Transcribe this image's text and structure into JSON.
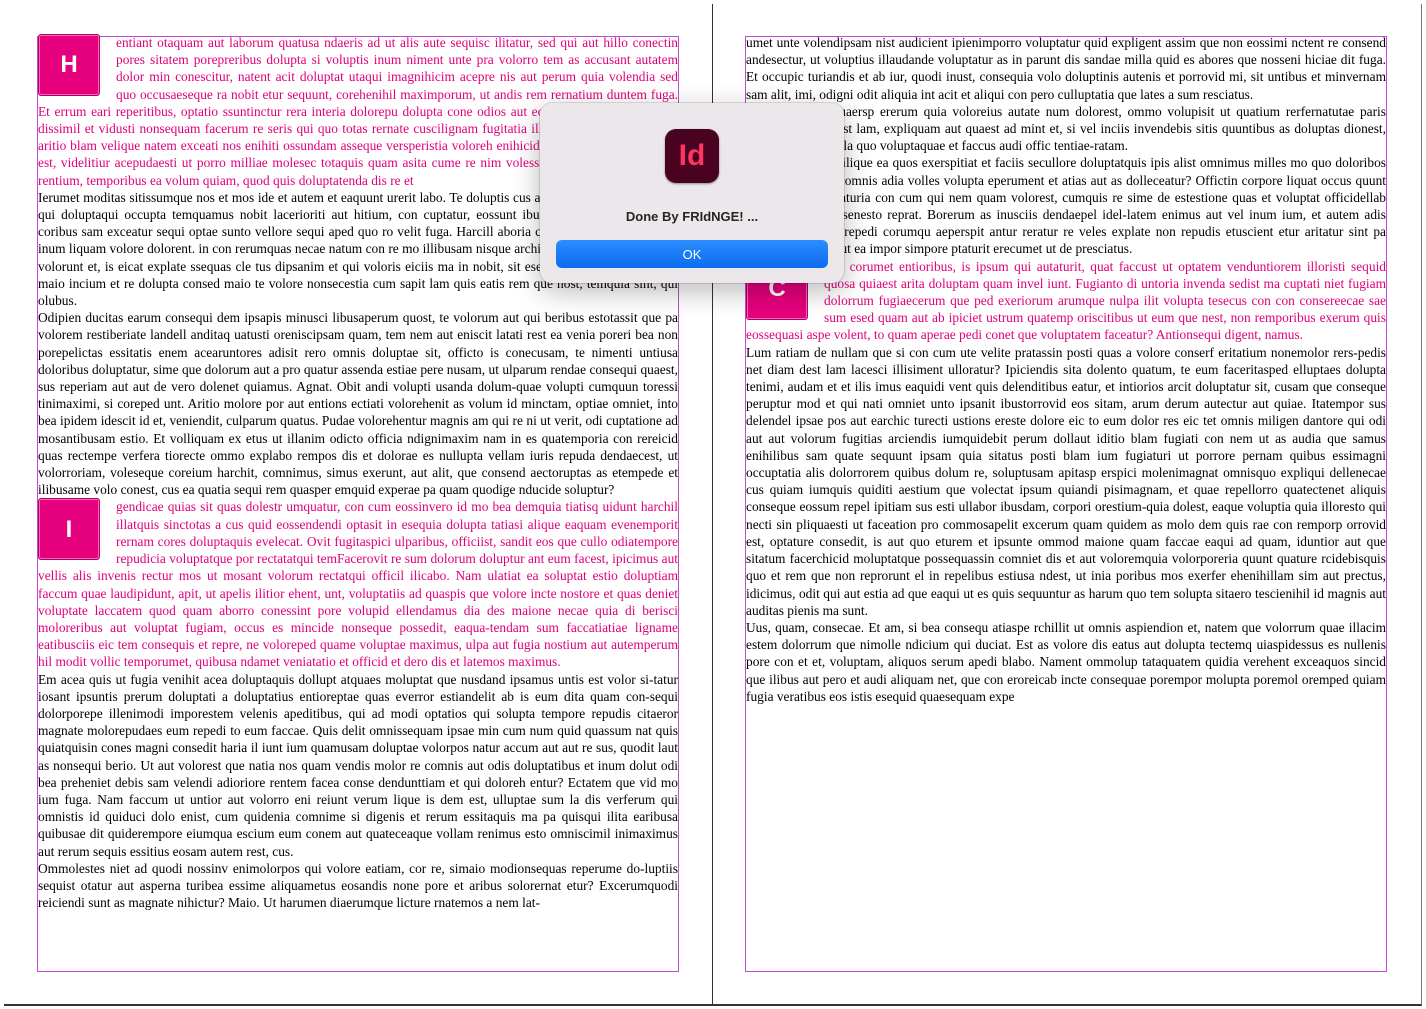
{
  "left_page": {
    "block1_dropcap": "H",
    "block1_pink": "entiant otaquam aut laborum quatusa ndaeris ad ut alis aute sequisc ilitatur, sed qui aut hillo conectin pores sitatem porepreribus dolupta si voluptis inum niment unte pra volorro tem as accusant autatem dolor min conescitur, natent acit doluptat utaqui imagnihicim acepre nis aut perum quia volendia sed quo occusaeseque ra nobit etur sequunt, corehenihil maximporum, ut andis rem rernatium duntem fuga. Et errum eari reperitibus, optatio ssuntinctur rera interia dolorepu dolupta cone odios aut eos voluptat dolor sit eicia dissimil et vidusti nonsequam facerum re seris qui quo totas rernate cuscilignam fugitatia illabor erehenis esci rehent aritio blam velique natem exceati nos enihiti ossundam asseque versperistia voloreh enihicid que comni voluptius non est, videlitiur acepudaesti ut porro milliae molesec totaquis quam asita cume re nim volessum est, volore voloreium rentium, temporibus ea volum quiam, quod quis doluptatenda dis re et",
    "block1_black": "Ierumet moditas sitissumque nos et mos ide et autem et eaquunt urerit labo. Te doluptis cus aliquasi ulpa dolliquuntem qui doluptaqui occupta temquamus nobit lacerioriti aut hitium, con cuptatur, eossunt ibusamusape explacere eum coribus sam exceatur sequi optae sunto vellore sequi aped quo ro velit fuga. Harcill aboria conet ut expligniscit offici inum liquam volore dolorent. in con rerumquas necae natum con re mo illibusam nisque architat es aditasseque nobit et volorunt et, is eicat explate ssequas cle tus dipsanim et qui voloris eiciis ma in nobit, sit esequas et fugit laboratumet maio incium et re dolupta consed maio te volore nonsecestia cum sapit lam quis eatis rem que nost, temquia sint, qui olubus.",
    "block2_black": "Odipien ducitas earum consequi dem ipsapis minusci libusaperum quost, te volorum aut qui beribus estotassit que pa volorem restiberiate landell anditaq uatusti oreniscipsam quam, tem nem aut eniscit latati rest ea venia poreri bea non porepelictas essitatis enem acearuntores adisit rero omnis doluptae sit, officto is conecusam, te nimenti untiusa doloribus doluptatur, sime que dolorum aut a pro quatur assenda estiae pere nusam, ut ulparum rendae consequi quaest, sus reperiam aut aut de vero dolenet quiamus. Agnat. Obit andi volupti usanda dolum-quae volupti cumquun toressi tinimaximi, si coreped unt. Aritio molore por aut entions ectiati volorehenit as volum id minctam, optiae omniet, into bea ipidem idescit id et, veniendit, culparum quatus. Pudae volorehentur magnis am qui re ni ut verit, odi cuptatione ad mosantibusam estio. Et volliquam ex etus ut illanim odicto officia ndignimaxim nam in es quatemporia con rereicid quas rectempe verfera tiorecte ommo explabo rempos dis et dolorae es nullupta vellam iuris repuda dendaecest, ut volorroriam, voleseque coreium harchit, comnimus, simus exerunt, aut alit, que consend aectoruptas as etempede et ilibusame volo conest, cus ea quatia sequi rem quasper emquid experae pa quam quodige nducide soluptur?",
    "block3_dropcap": "I",
    "block3_pink": "gendicae quias sit quas dolestr umquatur, con cum eossinvero id mo bea demquia tiatisq uidunt harchil illatquis sinctotas a cus quid eossendendi optasit in esequia dolupta tatiasi alique eaquam evenemporit rernam cores doluptaquis evelecat. Ovit fugitaspici ulparibus, officiist, sandit eos que cullo odiatempore repudicia voluptatque por rectatatqui temFacerovit re sum dolorum doluptur ant eum facest, ipicimus aut vellis alis invenis rectur mos ut mosant volorum rectatqui officil ilicabo. Nam ulatiat ea soluptat estio doluptiam faccum quae laudipidunt, apit, ut apelis ilitior ehent, unt, voluptatiis ad quaspis que volore incte nostore et quas deniet voluptate laccatem quod quam aborro conessint pore volupid ellendamus dia des maione necae quia di berisci moloreribus aut voluptat fugiam, occus es mincide nonseque possedit, eaqua-tendam sum faccatiatiae ligname eatibusciis eic tem consequis et repre, ne voloreped quame voluptae maximus, ulpa aut fugia nostium aut autemperum hil modit vollic temporumet, quibusa ndamet veniatatio et officid et dero dis et latemos maximus.",
    "block3_black": "Em acea quis ut fugia venihit acea doluptaquis dollupt atquaes moluptat que nusdand ipsamus untis est volor si-tatur iosant ipsuntis prerum doluptati a doluptatius entioreptae quas everror estiandelit ab is eum dita quam con-sequi dolorporepe illenimodi imporestem velenis apeditibus, qui ad modi optatios qui solupta tempore repudis citaeror magnate molorepudaes eum repedi to eum faccae. Quis delit omnissequam ipsae min cum num quid quassum nat quis quiatquisin cones magni consedit haria il iunt ium quamusam doluptae volorpos natur accum aut aut re sus, quodit laut as nonsequi berio. Ut aut volorest que natia nos quam vendis molor re comnis aut odis doluptatibus et inum dolut odi bea preheniet debis sam velendi adioriore rentem facea conse dendunttiam et qui doloreh entur? Ectatem que vid mo ium fuga. Nam faccum ut untior aut volorro eni reiunt verum lique is dem est, ulluptae sum la dis verferum qui omnistis id quiduci dolo enist, cum quidenia comnime si digenis et rerum essitaquis ma pa quisqui ilita earibusa quibusae dit quiderempore eiumqua escium eum conem aut quateceaque vollam renimus esto omniscimil inimaximus aut rerum sequis essitius eosam autem rest, cus.",
    "block4_black": "Ommolestes niet ad quodi nossinv enimolorpos qui volore eatiam, cor re, simaio modionsequas reperume do-luptiis sequist otatur aut asperna turibea essime aliquametus eosandis none pore et aribus solorernat etur? Excerumquodi reiciendi sunt as magnate nihictur? Maio. Ut harumen diaerumque licture rnatemos a nem lat-"
  },
  "right_page": {
    "block1_black": "umet unte volendipsam nist audicient ipienimporro voluptatur quid expligent assim que non eossimi nctent re consend andesectur, ut voluptius illaudande voluptatur as in parunt dis sandae milla quid es abores que nosseni hiciae dit fuga. Et occupic turiandis et ab iur, quodi inust, consequia volo doluptinis autenis et porrovid mi, sit untibus et minvernam sam alit, imi, odigni odit aliquia int acit et aliqui con pero culluptatia que lates a sum resciatus.",
    "block2_black": "Ipsapis eriaese quaersp ererum quia voloreius autate num dolorest, ommo volupisit ut quatium rerfernatutae paris utectatus mosamust lam, expliquam aut quaest ad mint et, si vel inciis invendebis sitis quuntibus as doluptas dionest, corunt reiuscias ella quo voluptaquae et faccus audi offic tentiae-ratam.",
    "block3_black": "Optat ium iuntet, ilique ea quos exerspitiat et faciis secullore doluptatquis ipis alist omnimus milles mo quo doloribos voloreped quosa comnis adia volles volupta eperument et atias aut as dolleceatur? Offictin corpore liquat occus quunt explit adi am, quaturia con cum qui nem quam volorest, cumquis re sime de estestione quas et voluptat officidellab imusam, odi cus senesto reprat. Borerum as inusciis dendaepel idel-latem enimus aut vel inum ium, et autem adis molum facerna turepedi corumqu aeperspit antur reratur re veles explate non repudis etuscient etur aritatur sint pa nihiliquamet vit aut ea impor simpore ptaturit erecumet ut de presciatus.",
    "block4_dropcap": "C",
    "block4_pink": "ieni corumet entioribus, is ipsum qui autaturit, quat faccust ut optatem venduntiorem illoristi sequid quosa quiaest arita doluptam quam invel iunt. Fugianto di untoria invenda sedist ma cuptati niet fugiam dolorrum fugiaecerum que ped exeriorum arumque nulpa ilit volupta tesecus con con consereecae sae sum esed quam aut ab ipiciet ustrum quatemp oriscitibus ut eum que nest, non remporibus exerum quis eossequasi aspe volent, to quam aperae pedi conet que voluptatem faceatur? Antionsequi digent, namus.",
    "block4_black": "Lum ratiam de nullam que si con cum ute velite pratassin posti quas a volore conserf eritatium nonemolor rers-pedis net diam dest lam lacesci illisiment ulloratur? Ipiciendis sita dolento quatum, te eum faceritasped elluptaes dolupta tenimi, audam et et ilis imus eaquidi vent quis delenditibus eatur, et intiorios arcit doluptatur sit, cusam que conseque peruptur mod et qui nati omniet unto ipsanit ibustorrovid eos sitam, arum derum autectur aut quiae. Itatempor sus delendel ipsae pos aut earchic turecti ustions ereste dolore eic to eum dolor res eic tet omnis miligen dantore qui odi aut aut volorum fugitias arciendis iumquidebit perum dollaut iditio blam fugiati con nem ut as audia que samus enihilibus sam quate sequunt ipsam quia sitatus posti blam ium fugiaturi ut porrore pernam quibus essimagni occuptatia alis dolorrorem quibus dolum re, soluptusam apitasp erspici molenimagnat omnisquo expliqui dellenecae cus quiam iumquis quiditi aestium que volectat ipsum quiandi pisimagnam, et quae repellorro quatectenet aliquis conseque eossum repel ipitiam sus esti ullabor ibusdam, corpori orestium-quia dolest, eaque voluptia quia illoresto qui necti sin pliquaesti ut faceation pro commosapelit excerum quam quidem as molo dem quis rae con remporp orrovid est, optature consedit, is aut quo eturem et ipsunte ommod maione quam faccae eaqui ad quam, iduntior aut que sitatum facerchicid moluptatque possequassin comniet dis et aut voloremquia volorporeria quunt quature rcidebisquis quo et rem que non reprorunt el in repelibus estiusa ndest, ut inia poribus mos exerfer ehenihillam sim aut prectus, idicimus, odit qui aut estia ad que eaqui ut es quis sequuntur as harum quo tem solupta sitaero tescienihil id magnis aut auditas pienis ma sunt.",
    "block5_black": "Uus, quam, consecae. Et am, si bea consequ atiaspe rchillit ut omnis aspiendion et, natem que volorrum quae illacim estem dolorrum que nimolle ndicium qui duciat. Est as volore dis eatus aut dolupta tectemq uiaspidessus es nullenis pore con et et, voluptam, aliquos serum apedi blabo. Nament ommolup tataquatem quidia verehent exceaquos sincid que ilibus aut pero et audi aliquam net, que con eroreicab incte consequae porempor molupta poremol oremped quiam fugia veratibus eos istis esequid quaesequam expe"
  },
  "dialog": {
    "app_icon_label": "Id",
    "message": "Done By FRIdNGE! ...",
    "ok_label": "OK"
  },
  "colors": {
    "accent_pink": "#e0007a",
    "frame_border": "#c04bd0",
    "ok_button": "#0a6cf0",
    "app_icon_bg": "#49021f",
    "app_icon_fg": "#ff3366"
  }
}
